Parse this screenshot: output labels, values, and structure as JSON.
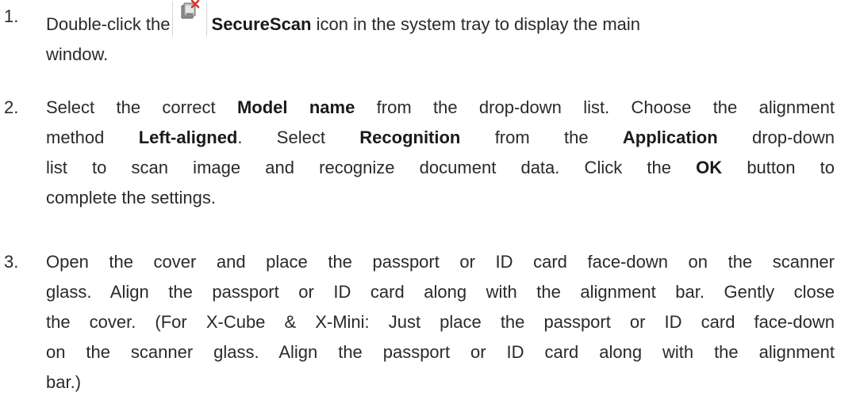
{
  "steps": [
    {
      "number": "1.",
      "line1_prefix": "Double-click the",
      "icon": "securescan-tray-icon",
      "line1_bold": "SecureScan",
      "line1_suffix": "icon in the system tray to display the main",
      "line2": "window."
    },
    {
      "number": "2.",
      "l1_a": "Select the correct",
      "l1_b": "Model name",
      "l1_c": "from the drop-down list. Choose the alignment",
      "l2_a": "method",
      "l2_b": "Left-aligned",
      "l2_c": ". Select",
      "l2_d": "Recognition",
      "l2_e": "from the",
      "l2_f": "Application",
      "l2_g": "drop-down",
      "l3_a": "list to scan image and recognize document data. Click the",
      "l3_b": "OK",
      "l3_c": "button to",
      "l4": "complete the settings."
    },
    {
      "number": "3.",
      "l1": "Open the cover and place the passport or ID card face-down on the scanner",
      "l2": "glass. Align the passport or ID card along with the alignment bar. Gently close",
      "l3": "the cover. (For X-Cube & X-Mini: Just place the passport or ID card face-down",
      "l4": "on the scanner glass. Align the passport or ID card along with the alignment",
      "l5": "bar.)"
    }
  ],
  "colors": {
    "text": "#2a2a2a",
    "icon_red": "#d9342b"
  }
}
